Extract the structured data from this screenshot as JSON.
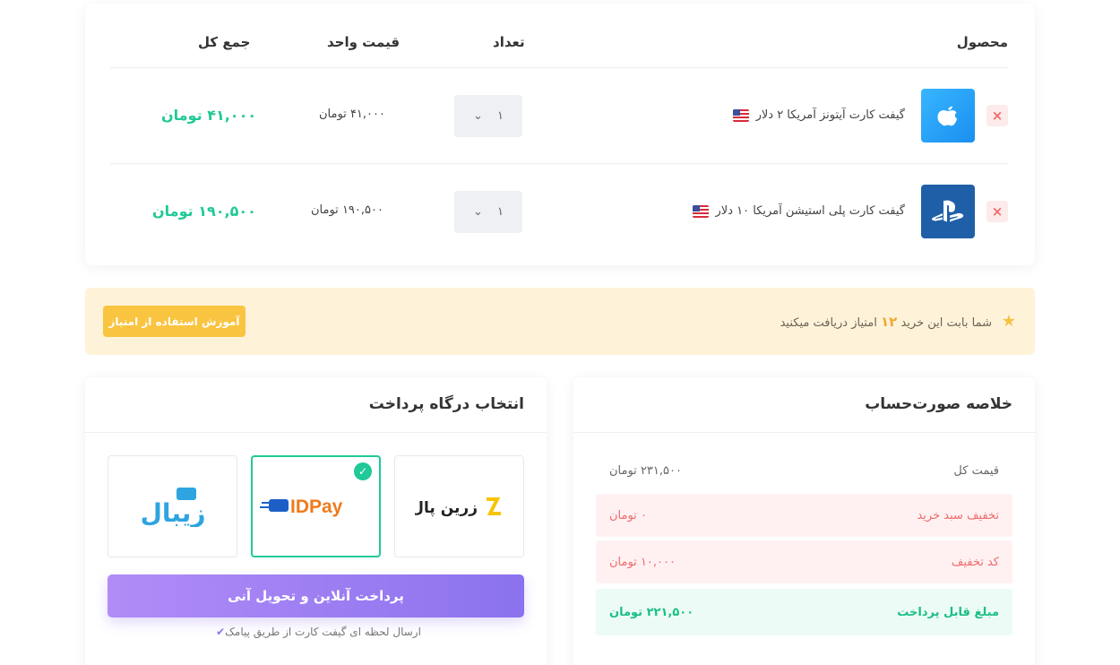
{
  "cart": {
    "headers": {
      "product": "محصول",
      "quantity": "تعداد",
      "unit_price": "قیمت واحد",
      "total": "جمع کل"
    },
    "items": [
      {
        "remove": "×",
        "icon": "apple-logo-icon",
        "name": "گیفت کارت آیتونز آمریکا ۲ دلار",
        "qty": "۱",
        "unit_price": "۴۱,۰۰۰  تومان",
        "total": "۴۱,۰۰۰ تومان"
      },
      {
        "remove": "×",
        "icon": "playstation-logo-icon",
        "name": "گیفت کارت پلی استیشن آمریکا ۱۰ دلار",
        "qty": "۱",
        "unit_price": "۱۹۰,۵۰۰  تومان",
        "total": "۱۹۰,۵۰۰ تومان"
      }
    ]
  },
  "points": {
    "text_before": "شما بابت این خرید",
    "points_value": "۱۲",
    "text_after": "امتیاز دریافت میکنید",
    "button": "آموزش استفاده از امتیاز"
  },
  "gateway": {
    "title": "انتخاب درگاه پرداخت",
    "options": [
      {
        "name": "زرین پال",
        "selected": false
      },
      {
        "name": "IDPay",
        "selected": true
      },
      {
        "name": "زیبال",
        "selected": false
      }
    ],
    "pay_button": "پرداخت آنلاین و تحویل آنی",
    "sms_note": "ارسال لحظه ای گیفت کارت از طریق پیامک"
  },
  "summary": {
    "title": "خلاصه صورت‌حساب",
    "rows": [
      {
        "label": "قیمت کل",
        "value": "۲۳۱,۵۰۰ تومان"
      },
      {
        "label": "تخفیف سبد خرید",
        "value": "۰ تومان"
      },
      {
        "label": "کد تخفیف",
        "value": "۱۰,۰۰۰ تومان"
      },
      {
        "label": "مبلغ قابل پرداخت",
        "value": "۲۲۱,۵۰۰ تومان"
      }
    ]
  },
  "colors": {
    "accent_green": "#20c997",
    "accent_purple": "#8b72ee",
    "warning_yellow": "#f9c440",
    "danger_red": "#f06a6a"
  }
}
